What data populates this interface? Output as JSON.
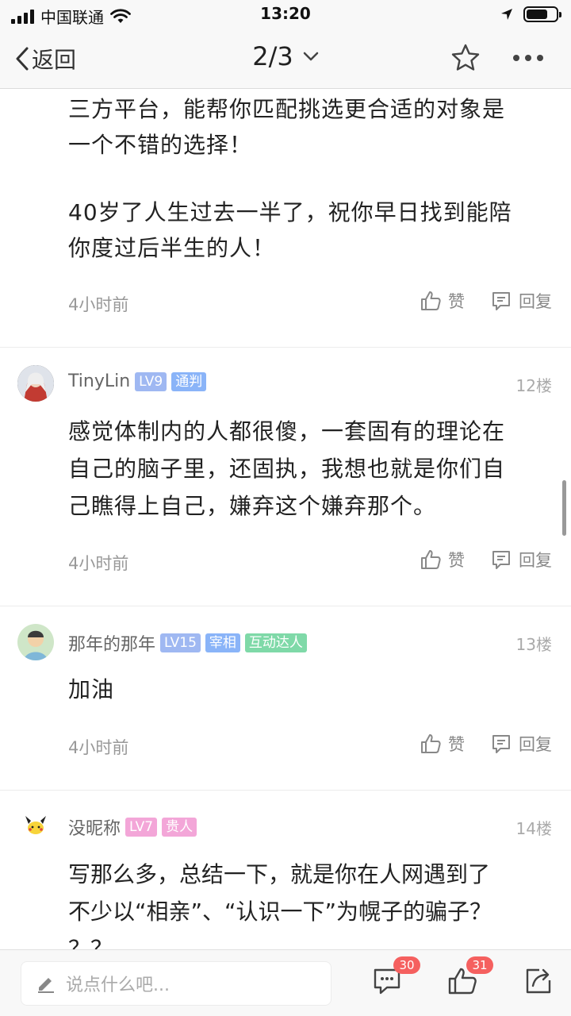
{
  "status_bar": {
    "carrier": "中国联通",
    "time": "13:20"
  },
  "nav": {
    "back_label": "返回",
    "page_indicator": "2/3"
  },
  "posts": [
    {
      "text_lines": [
        "三方平台，能帮你匹配挑选更合适的对象是",
        "一个不错的选择！",
        "",
        "40岁了人生过去一半了，祝你早日找到能陪",
        "你度过后半生的人！"
      ],
      "time": "4小时前",
      "like_label": "赞",
      "reply_label": "回复"
    },
    {
      "username": "TinyLin",
      "level": "LV9",
      "title_tag": "通判",
      "floor": "12楼",
      "text_lines": [
        "感觉体制内的人都很傻，一套固有的理论在",
        "自己的脑子里，还固执，我想也就是你们自",
        "己瞧得上自己，嫌弃这个嫌弃那个。"
      ],
      "time": "4小时前",
      "like_label": "赞",
      "reply_label": "回复"
    },
    {
      "username": "那年的那年",
      "level": "LV15",
      "title_tag": "宰相",
      "extra_tag": "互动达人",
      "floor": "13楼",
      "text_lines": [
        "加油"
      ],
      "time": "4小时前",
      "like_label": "赞",
      "reply_label": "回复"
    },
    {
      "username": "没昵称",
      "level": "LV7",
      "title_tag": "贵人",
      "floor": "14楼",
      "text_lines": [
        "写那么多，总结一下，就是你在人网遇到了",
        "不少以“相亲”、“认识一下”为幌子的骗子？",
        "？？"
      ]
    }
  ],
  "bottom_bar": {
    "input_placeholder": "说点什么吧...",
    "comment_count": "30",
    "like_count": "31"
  },
  "colors": {
    "level_tag": "#9fb8f2",
    "title_tag_blue": "#8ab4f8",
    "title_tag_green": "#7fd9a8",
    "pink_tag": "#f3a6d8",
    "badge_red": "#f5605f"
  }
}
